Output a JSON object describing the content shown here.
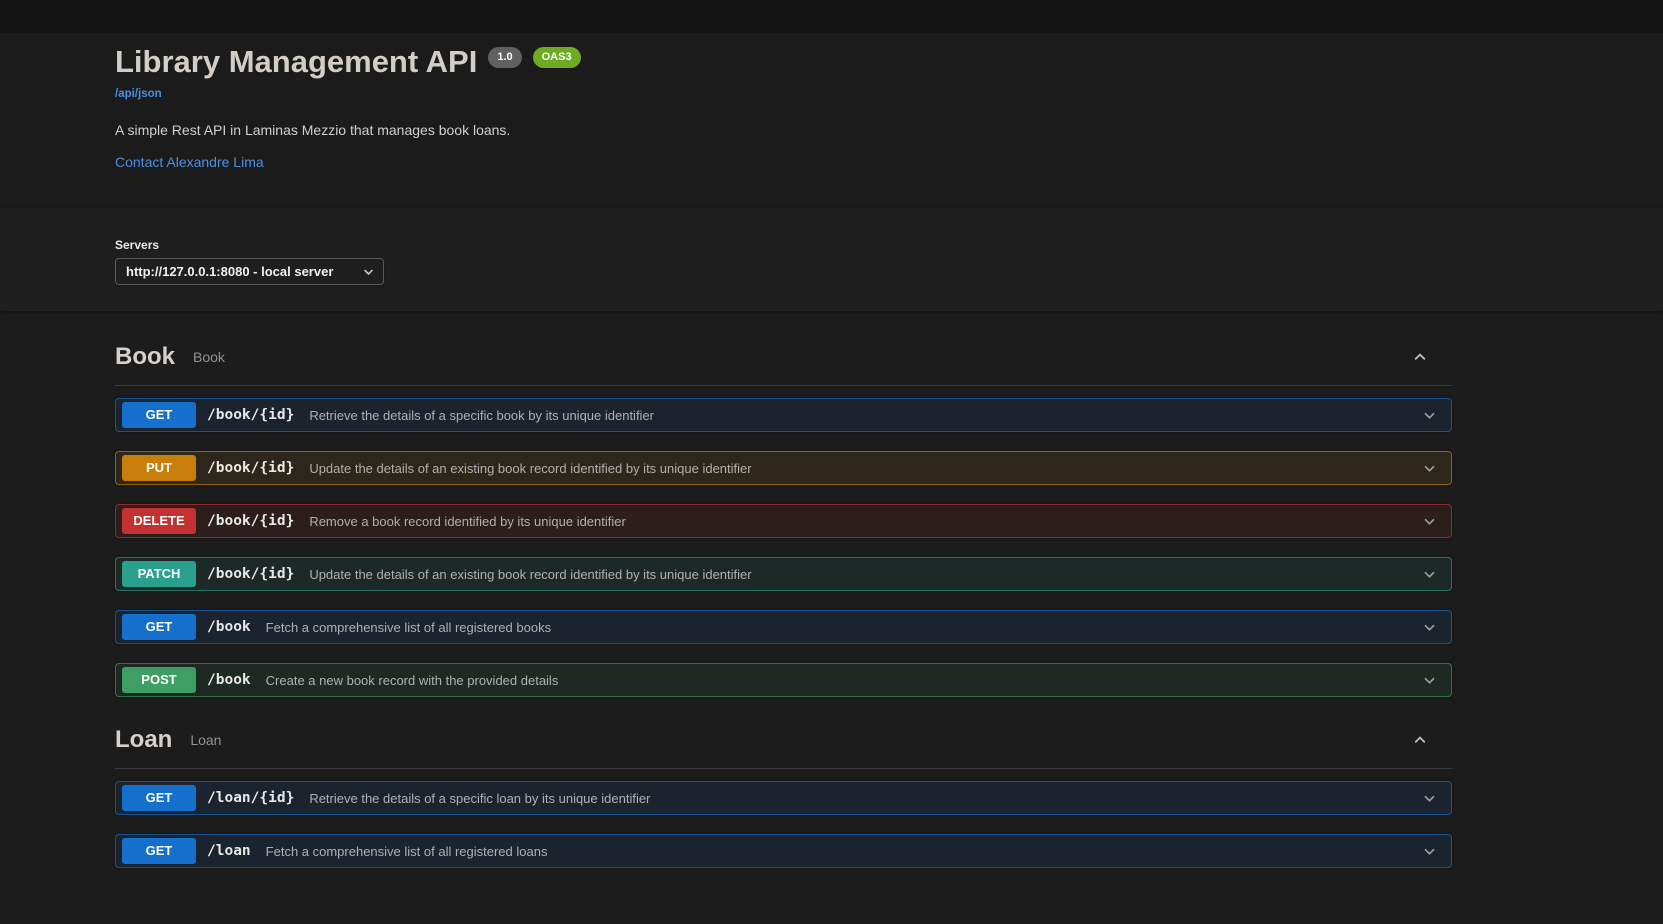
{
  "header": {
    "title": "Library Management API",
    "version_badge": "1.0",
    "oas_badge": "OAS3",
    "spec_link": "/api/json",
    "description": "A simple Rest API in Laminas Mezzio that manages book loans.",
    "contact_link": "Contact Alexandre Lima"
  },
  "servers": {
    "label": "Servers",
    "selected_option": "http://127.0.0.1:8080 - local server"
  },
  "sections": [
    {
      "name": "Book",
      "subtitle": "Book",
      "operations": [
        {
          "method": "GET",
          "path": "/book/{id}",
          "summary": "Retrieve the details of a specific book by its unique identifier"
        },
        {
          "method": "PUT",
          "path": "/book/{id}",
          "summary": "Update the details of an existing book record identified by its unique identifier"
        },
        {
          "method": "DELETE",
          "path": "/book/{id}",
          "summary": "Remove a book record identified by its unique identifier"
        },
        {
          "method": "PATCH",
          "path": "/book/{id}",
          "summary": "Update the details of an existing book record identified by its unique identifier"
        },
        {
          "method": "GET",
          "path": "/book",
          "summary": "Fetch a comprehensive list of all registered books"
        },
        {
          "method": "POST",
          "path": "/book",
          "summary": "Create a new book record with the provided details"
        }
      ]
    },
    {
      "name": "Loan",
      "subtitle": "Loan",
      "operations": [
        {
          "method": "GET",
          "path": "/loan/{id}",
          "summary": "Retrieve the details of a specific loan by its unique identifier"
        },
        {
          "method": "GET",
          "path": "/loan",
          "summary": "Fetch a comprehensive list of all registered loans"
        }
      ]
    }
  ],
  "colors": {
    "version_badge_bg": "#606060",
    "oas_badge_bg": "#6cab22",
    "link": "#4990e2",
    "methods": {
      "GET": "#1470cc",
      "PUT": "#c77f0a",
      "DELETE": "#c43131",
      "PATCH": "#29a08c",
      "POST": "#3f9e63"
    }
  }
}
